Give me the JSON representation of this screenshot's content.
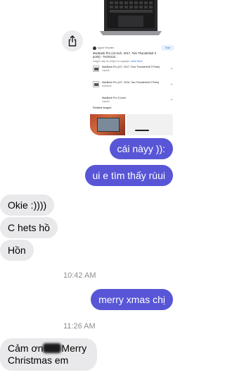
{
  "shared_card": {
    "source": "Apple Reseller",
    "visit_label": "Visit",
    "title": "MacBook Pro (13-inch, 2017, Two Thunderbolt 3 ports) - Technical ...",
    "note": "Images may be subject to copyright.",
    "learn_more": "Learn More",
    "products": [
      {
        "name": "MacBook Pro (13\", 2017, Four Thunderbolt 3 Ports)",
        "sub": "Laymat"
      },
      {
        "name": "MacBook Pro (13\", 2016, Two Thunderbolt 3 Ports)",
        "sub": "Notebook"
      },
      {
        "name": "MacBook Pro 13-inch",
        "sub": "Laymat"
      }
    ],
    "related_label": "Related images"
  },
  "messages": {
    "sent_1": "cái nàyy )):",
    "sent_2": "ui e tìm thấy rùui",
    "recv_1": "Okie :))))",
    "recv_2": "C hets hồ",
    "recv_3": "Hồn",
    "time_1": "10:42 AM",
    "sent_3": "merry xmas chị",
    "time_2": "11:26 AM",
    "recv_4_line1_start": "Cảm ơn",
    "recv_4_line1_end": "Merry",
    "recv_4_line2": "Christmas em"
  },
  "colors": {
    "sent_bubble": "#5856d6",
    "received_bubble": "#e9e9eb",
    "timestamp": "#8e8e93"
  }
}
